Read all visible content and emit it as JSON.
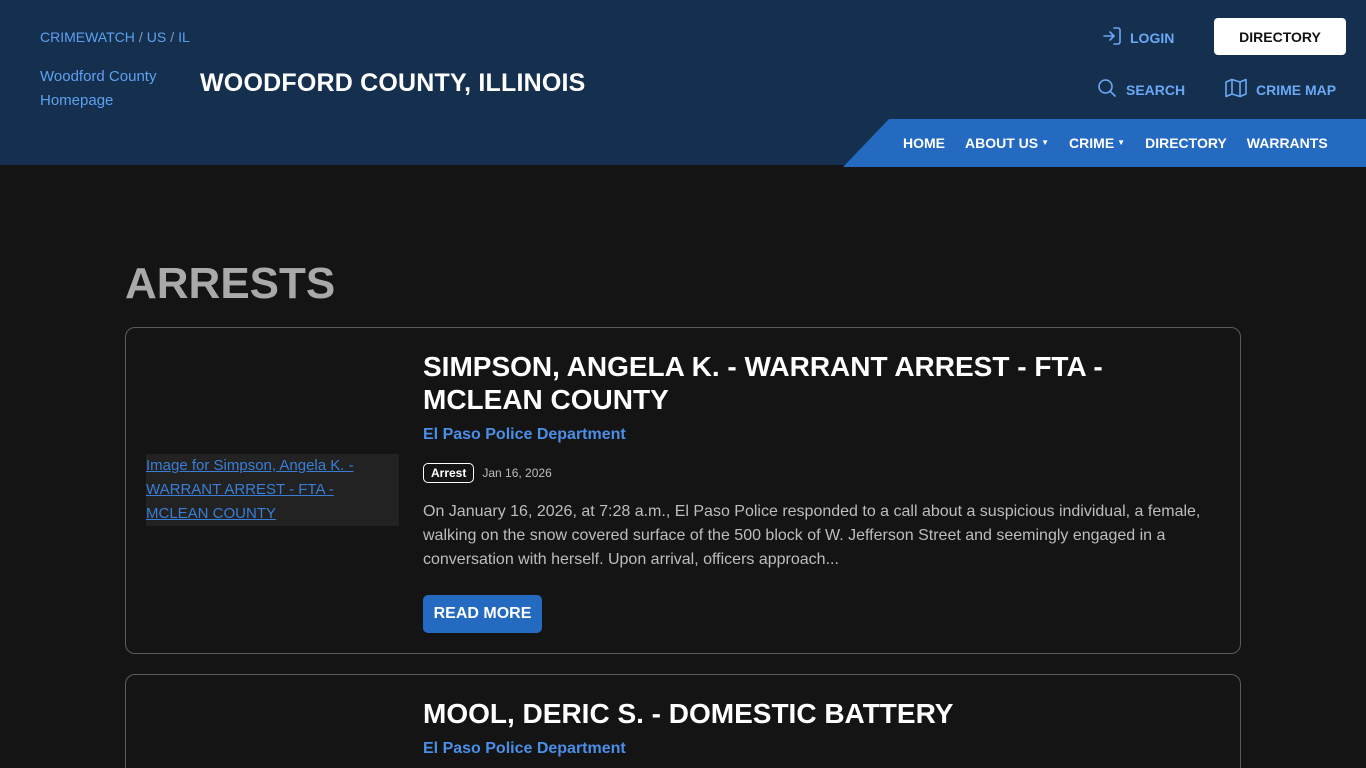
{
  "breadcrumb": {
    "items": [
      "CRIMEWATCH",
      "US",
      "IL"
    ],
    "separator": "/"
  },
  "header": {
    "logo_alt": "Woodford County Homepage",
    "site_title": "WOODFORD COUNTY, ILLINOIS",
    "login_label": "LOGIN",
    "directory_button": "DIRECTORY",
    "search_label": "SEARCH",
    "crime_map_label": "CRIME MAP"
  },
  "nav": {
    "items": [
      {
        "label": "HOME",
        "dropdown": false
      },
      {
        "label": "ABOUT US",
        "dropdown": true
      },
      {
        "label": "CRIME",
        "dropdown": true
      },
      {
        "label": "DIRECTORY",
        "dropdown": false
      },
      {
        "label": "WARRANTS",
        "dropdown": false
      }
    ]
  },
  "page": {
    "heading": "ARRESTS"
  },
  "articles": [
    {
      "image_alt": "Image for Simpson, Angela K. - WARRANT ARREST - FTA - MCLEAN COUNTY",
      "title": "SIMPSON, ANGELA K. - WARRANT ARREST - FTA - MCLEAN COUNTY",
      "agency": "El Paso Police Department",
      "category": "Arrest",
      "date": "Jan 16, 2026",
      "excerpt": "On January 16, 2026, at 7:28 a.m., El Paso Police responded to a call about a suspicious individual, a female, walking on the snow covered surface of the 500 block of W. Jefferson Street and seemingly engaged in a conversation with herself. Upon arrival, officers approach...",
      "read_more": "READ MORE"
    },
    {
      "title": "MOOL, DERIC S. - DOMESTIC BATTERY",
      "agency": "El Paso Police Department"
    }
  ],
  "colors": {
    "header_bg": "#15304f",
    "nav_bg": "#246ac1",
    "page_bg": "#141414",
    "link": "#4a8ee8"
  }
}
